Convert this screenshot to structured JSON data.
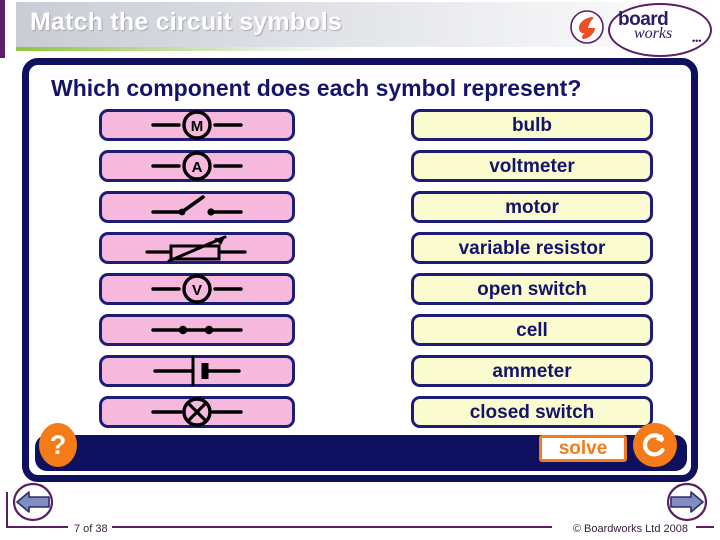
{
  "header": {
    "title": "Match the circuit symbols",
    "logo": {
      "brand_top": "board",
      "brand_bottom": "works",
      "dots": "•••"
    },
    "colors": {
      "accent_purple": "#5b1f63",
      "accent_green": "#8cc63e",
      "title_text": "#ffffff"
    }
  },
  "panel": {
    "question": "Which component does each symbol represent?",
    "border_color": "#101060",
    "symbol_card_fill": "#f6b8dd",
    "label_card_fill": "#fbfbd0",
    "symbols": [
      {
        "id": "motor",
        "icon": "meter-m-symbol",
        "alt": "M meter circle symbol"
      },
      {
        "id": "ammeter",
        "icon": "meter-a-symbol",
        "alt": "A meter circle symbol"
      },
      {
        "id": "open-switch",
        "icon": "open-switch-symbol",
        "alt": "open switch symbol"
      },
      {
        "id": "variable-resistor",
        "icon": "variable-resistor-symbol",
        "alt": "resistor with diagonal arrow"
      },
      {
        "id": "voltmeter",
        "icon": "meter-v-symbol",
        "alt": "V meter circle symbol"
      },
      {
        "id": "closed-switch",
        "icon": "closed-switch-symbol",
        "alt": "closed switch symbol"
      },
      {
        "id": "cell",
        "icon": "cell-symbol",
        "alt": "cell symbol"
      },
      {
        "id": "bulb",
        "icon": "bulb-symbol",
        "alt": "crossed circle bulb symbol"
      }
    ],
    "labels": [
      "bulb",
      "voltmeter",
      "motor",
      "variable resistor",
      "open switch",
      "cell",
      "ammeter",
      "closed switch"
    ],
    "toolbar": {
      "help_label": "?",
      "solve_label": "solve",
      "reset_icon": "reset-arrow-icon",
      "accent_orange": "#f47b18"
    }
  },
  "footer": {
    "page_number": "7 of 38",
    "copyright": "© Boardworks Ltd 2008",
    "prev_icon": "previous-arrow-icon",
    "next_icon": "next-arrow-icon"
  }
}
